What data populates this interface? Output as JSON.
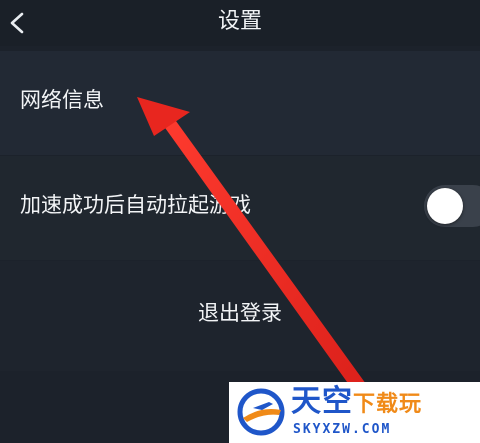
{
  "header": {
    "title": "设置",
    "back_icon": "chevron-left-icon"
  },
  "settings": {
    "network_info_label": "网络信息",
    "auto_launch_label": "加速成功后自动拉起游戏",
    "auto_launch_enabled": false,
    "logout_label": "退出登录"
  },
  "overlay": {
    "arrow_color": "#e8261f",
    "arrow_target": "network-info-item"
  },
  "watermark": {
    "main_text_blue": "天空",
    "main_text_orange": "下载玩",
    "domain": "SKYXZW.COM",
    "logo_icon": "airplane-globe-logo-icon",
    "blue_color": "#1f56c9",
    "orange_color": "#f08a18"
  },
  "colors": {
    "background": "#1c222b",
    "row_background": "#222934",
    "text": "#f3f5f7"
  }
}
